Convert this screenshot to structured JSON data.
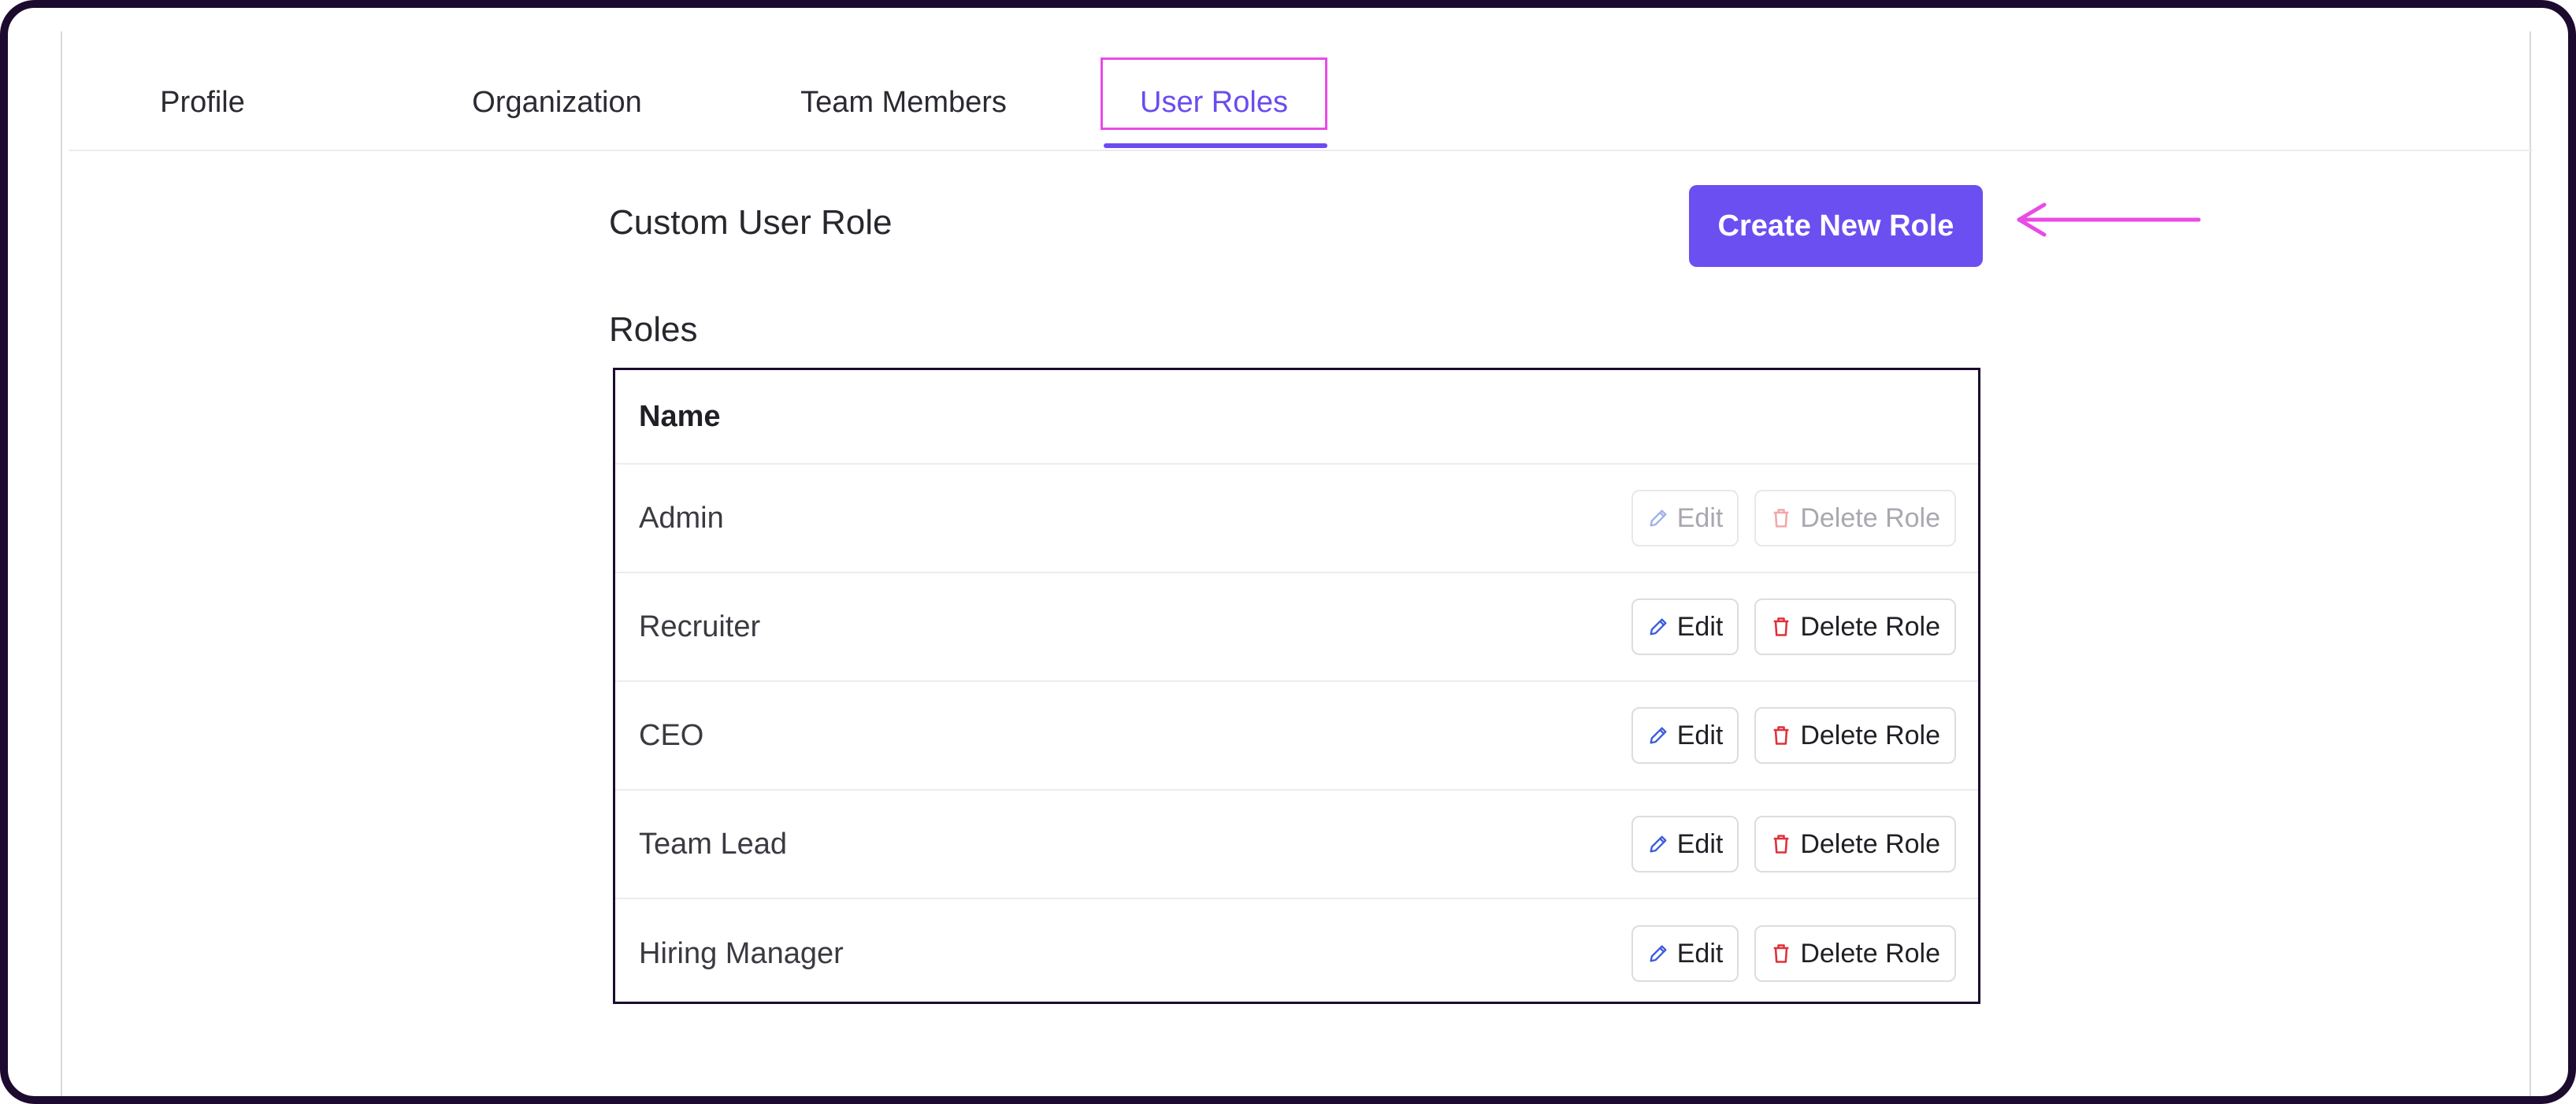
{
  "tabs": [
    {
      "label": "Profile"
    },
    {
      "label": "Organization"
    },
    {
      "label": "Team Members"
    },
    {
      "label": "User Roles",
      "active": true
    }
  ],
  "section_title": "Custom User Role",
  "create_button": "Create New Role",
  "roles_heading": "Roles",
  "table": {
    "header": "Name",
    "edit_label": "Edit",
    "delete_label": "Delete Role",
    "rows": [
      {
        "name": "Admin",
        "disabled": true
      },
      {
        "name": "Recruiter",
        "disabled": false
      },
      {
        "name": "CEO",
        "disabled": false
      },
      {
        "name": "Team Lead",
        "disabled": false
      },
      {
        "name": "Hiring Manager",
        "disabled": false
      }
    ]
  },
  "colors": {
    "accent": "#6c4ff0",
    "highlight": "#e84be6",
    "delete_icon": "#e0303a",
    "edit_icon": "#3b5bdb"
  }
}
